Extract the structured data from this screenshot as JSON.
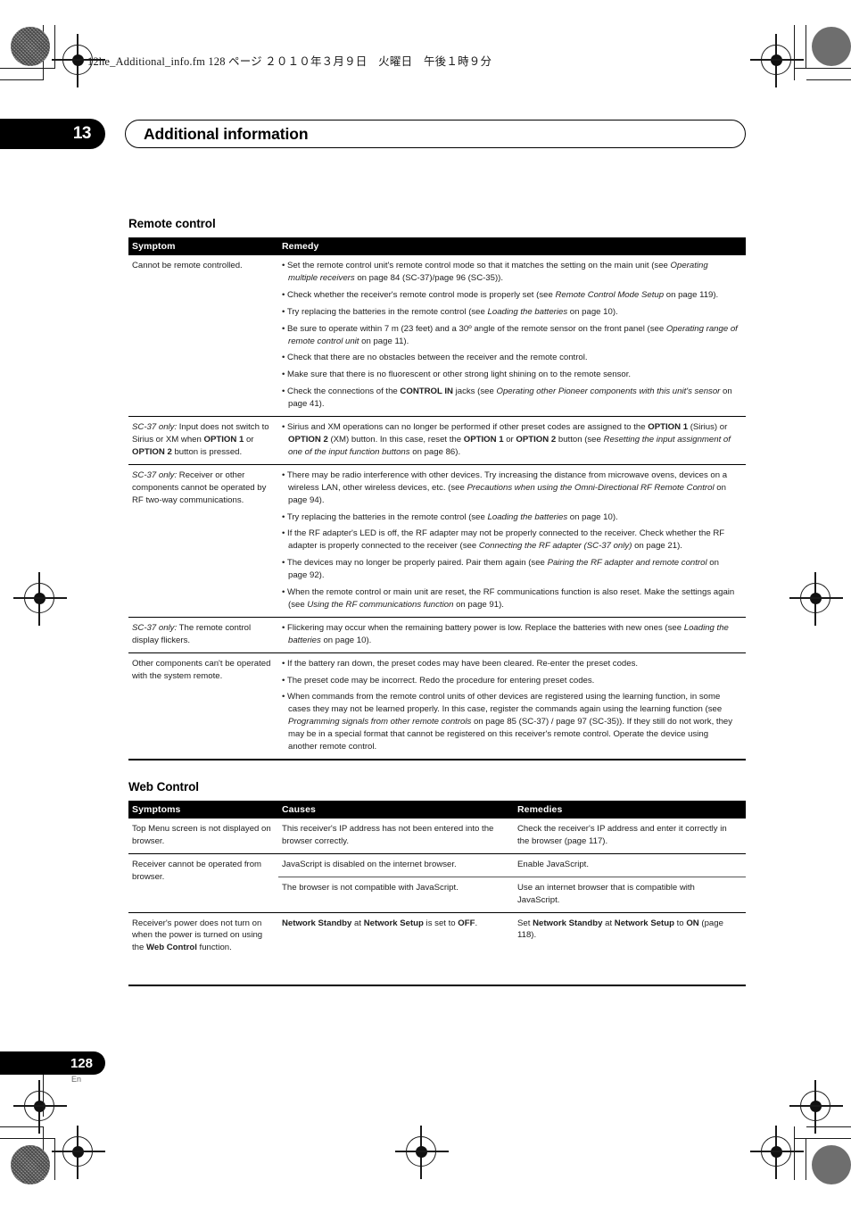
{
  "header": {
    "file_info": "12he_Additional_info.fm  128 ページ  ２０１０年３月９日　火曜日　午後１時９分",
    "chapter_number": "13",
    "chapter_title": "Additional information"
  },
  "sections": [
    {
      "heading": "Remote control",
      "columns": [
        "Symptom",
        "Remedy"
      ],
      "rows": [
        {
          "symptom": "Cannot be remote controlled.",
          "remedy": [
            "• Set the remote control unit's remote control mode so that it matches the setting on the main unit (see <i>Operating multiple receivers</i> on page 84 (SC-37)/page 96 (SC-35)).",
            "• Check whether the receiver's remote control mode is properly set (see <i>Remote Control Mode Setup</i> on page 119).",
            "• Try replacing the batteries in the remote control (see <i>Loading the batteries</i> on page 10).",
            "• Be sure to operate within 7 m (23 feet) and a 30º angle of the remote sensor on the front panel (see <i>Operating range of remote control unit</i> on page 11).",
            "• Check that there are no obstacles between the receiver and the remote control.",
            "• Make sure that there is no fluorescent or other strong light shining on to the remote sensor.",
            "• Check the connections of the <b>CONTROL IN</b> jacks (see <i>Operating other Pioneer components with this unit's sensor</i> on page 41)."
          ]
        },
        {
          "symptom": "<i>SC-37 only:</i> Input does not switch to Sirius or XM when <b>OPTION 1</b> or <b>OPTION 2</b> button is pressed.",
          "remedy": [
            "• Sirius and XM operations can no longer be performed if other preset codes are assigned to the <b>OPTION 1</b> (Sirius) or <b>OPTION 2</b> (XM) button. In this case, reset the <b>OPTION 1</b> or <b>OPTION 2</b> button (see <i>Resetting the input assignment of one of the input function buttons</i> on page 86)."
          ]
        },
        {
          "symptom": "<i>SC-37 only:</i> Receiver or other components cannot be operated by RF two-way communications.",
          "remedy": [
            "• There may be radio interference with other devices. Try increasing the distance from microwave ovens, devices on a wireless LAN, other wireless devices, etc. (see <i>Precautions when using the Omni-Directional RF Remote Control</i> on page 94).",
            "• Try replacing the batteries in the remote control (see <i>Loading the batteries</i> on page 10).",
            "• If the RF adapter's LED is off, the RF adapter may not be properly connected to the receiver. Check whether the RF adapter is properly connected to the receiver (see <i>Connecting the RF adapter (SC-37 only)</i> on page 21).",
            "• The devices may no longer be properly paired. Pair them again (see <i>Pairing the RF adapter and remote control</i> on page 92).",
            "• When the remote control or main unit are reset, the RF communications function is also reset. Make the settings again (see <i>Using the RF communications function</i> on page 91)."
          ]
        },
        {
          "symptom": "<i>SC-37 only:</i> The remote control display flickers.",
          "remedy": [
            "• Flickering may occur when the remaining battery power is low. Replace the batteries with new ones (see <i>Loading the batteries</i> on page 10)."
          ]
        },
        {
          "symptom": "Other components can't be operated with the system remote.",
          "remedy": [
            "• If the battery ran down, the preset codes may have been cleared. Re-enter the preset codes.",
            "• The preset code may be incorrect. Redo the procedure for entering preset codes.",
            "• When commands from the remote control units of other devices are registered using the learning function, in some cases they may not be learned properly. In this case, register the commands again using the learning function (see <i>Programming signals from other remote controls</i> on page 85 (SC-37) / page 97 (SC-35)). If they still do not work, they may be in a special format that cannot be registered on this receiver's remote control. Operate the device using another remote control."
          ]
        }
      ]
    }
  ],
  "web_control": {
    "heading": "Web Control",
    "columns": [
      "Symptoms",
      "Causes",
      "Remedies"
    ],
    "rows": [
      {
        "symptom": "Top Menu screen is not displayed on browser.",
        "cause": "This receiver's IP address has not been entered into the browser correctly.",
        "remedy": "Check the receiver's IP address and enter it correctly in the browser (page 117)."
      },
      {
        "symptom": "Receiver cannot be operated from browser.",
        "cause": "JavaScript is disabled on the internet browser.",
        "remedy": "Enable JavaScript."
      },
      {
        "symptom": "",
        "cause": "The browser is not compatible with JavaScript.",
        "remedy": "Use an internet browser that is compatible with JavaScript."
      },
      {
        "symptom": "Receiver's power does not turn on when the power is turned on using the <b>Web Control</b> function.",
        "cause": "<b>Network Standby</b> at <b>Network Setup</b> is set to <b>OFF</b>.",
        "remedy": "Set <b>Network Standby</b> at <b>Network Setup</b> to <b>ON</b> (page 118)."
      }
    ]
  },
  "footer": {
    "page_number": "128",
    "language_code": "En"
  }
}
